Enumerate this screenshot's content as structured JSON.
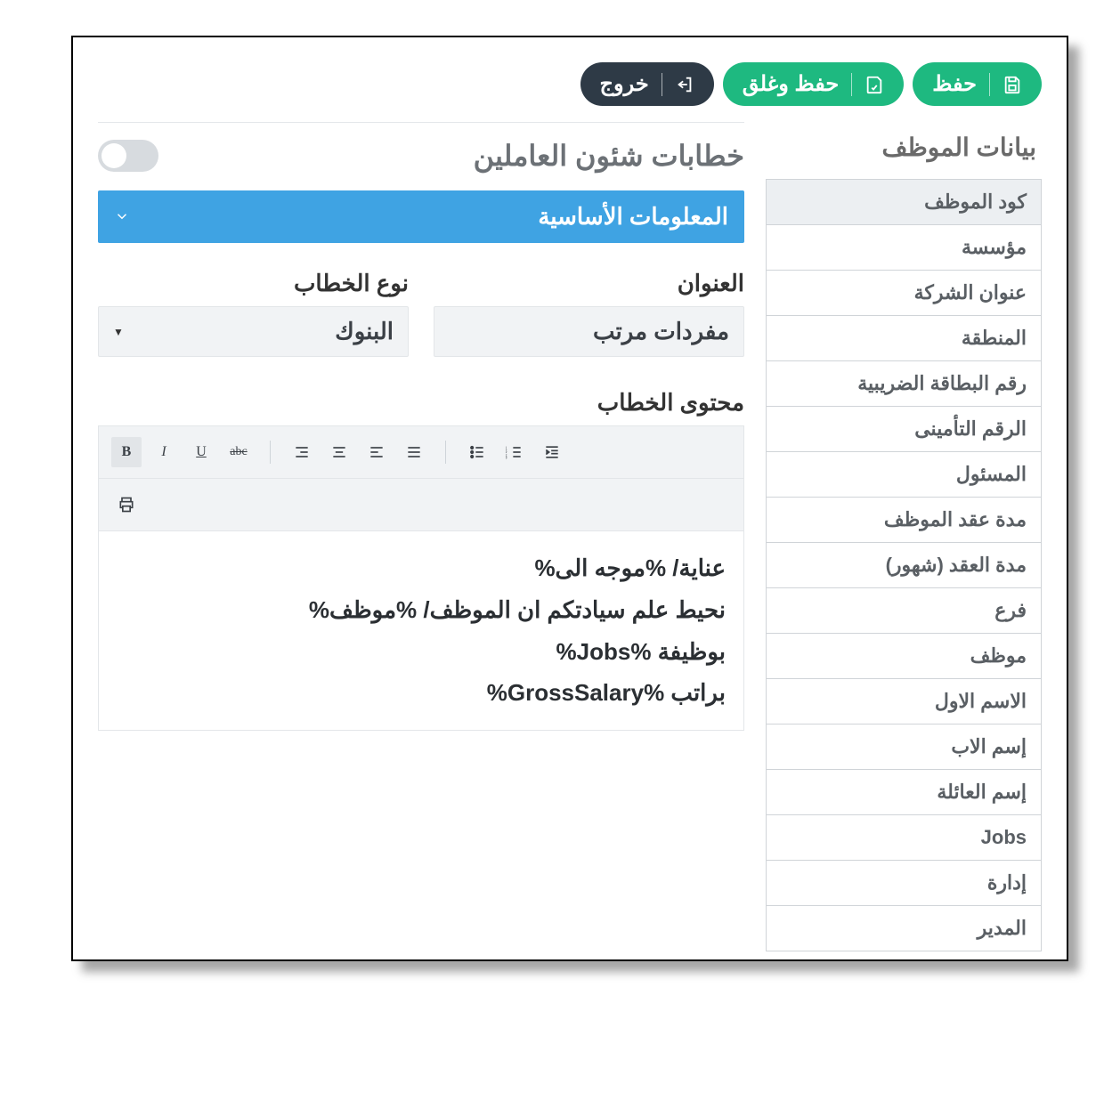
{
  "toolbar": {
    "save_label": "حفظ",
    "save_close_label": "حفظ وغلق",
    "exit_label": "خروج"
  },
  "sidebar": {
    "title": "بيانات الموظف",
    "items": [
      {
        "label": "كود الموظف",
        "active": true
      },
      {
        "label": "مؤسسة"
      },
      {
        "label": "عنوان الشركة"
      },
      {
        "label": "المنطقة"
      },
      {
        "label": "رقم البطاقة الضريبية"
      },
      {
        "label": "الرقم التأمينى"
      },
      {
        "label": "المسئول"
      },
      {
        "label": "مدة عقد الموظف"
      },
      {
        "label": "مدة العقد (شهور)"
      },
      {
        "label": "فرع"
      },
      {
        "label": "موظف"
      },
      {
        "label": "الاسم الاول"
      },
      {
        "label": "إسم الاب"
      },
      {
        "label": "إسم العائلة"
      },
      {
        "label": "Jobs"
      },
      {
        "label": "إدارة"
      },
      {
        "label": "المدير"
      }
    ]
  },
  "main": {
    "title": "خطابات شئون العاملين",
    "accordion": "المعلومات الأساسية",
    "fields": {
      "title_label": "العنوان",
      "title_value": "مفردات مرتب",
      "type_label": "نوع الخطاب",
      "type_value": "البنوك"
    },
    "editor_label": "محتوى الخطاب",
    "content_lines": [
      "عناية/ %موجه الى%",
      "نحيط علم سيادتكم ان الموظف/ %موظف%",
      "بوظيفة %Jobs%",
      "براتب %GrossSalary%"
    ]
  }
}
